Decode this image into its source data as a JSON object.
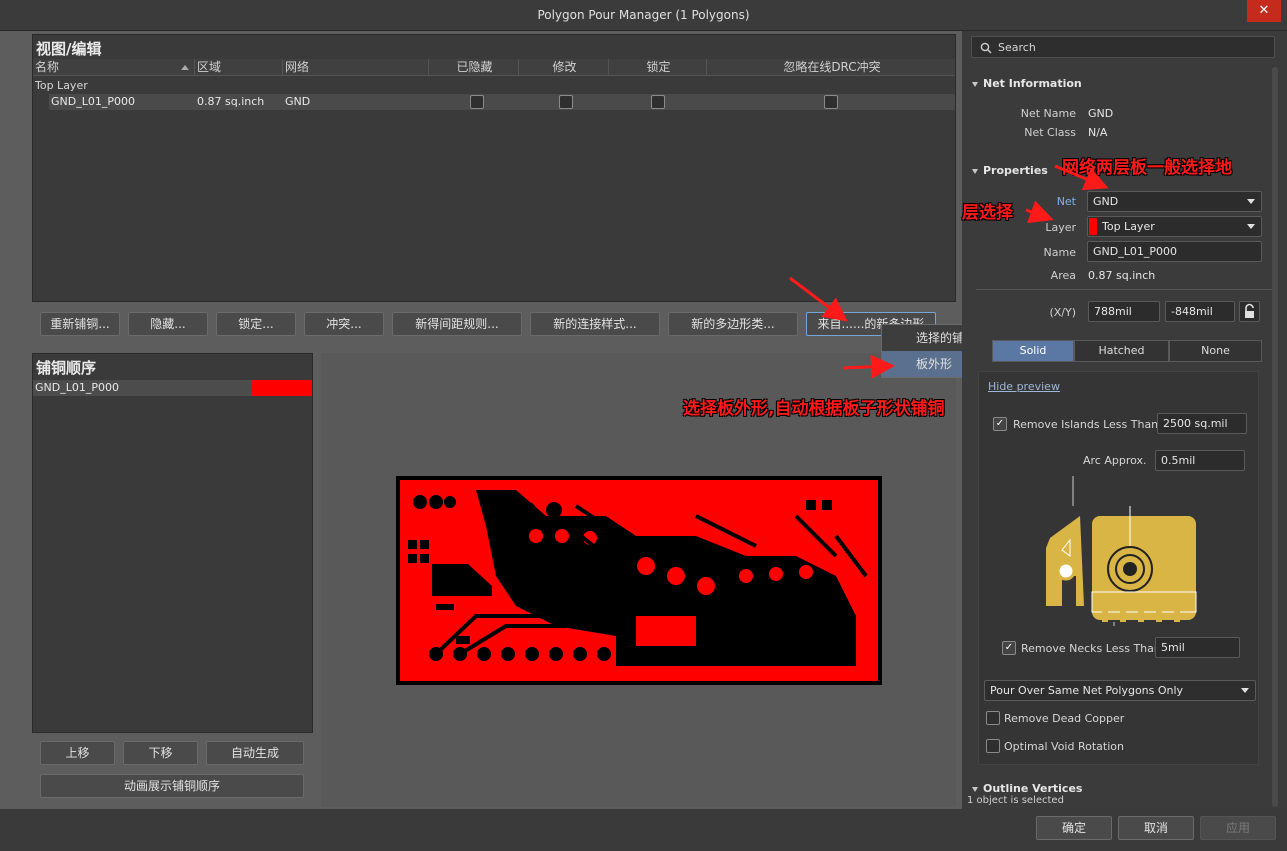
{
  "window": {
    "title": "Polygon Pour Manager (1 Polygons)",
    "close_glyph": "✕"
  },
  "view_edit": {
    "header": "视图/编辑",
    "columns": [
      "名称",
      "区域",
      "网络",
      "已隐藏",
      "修改",
      "锁定",
      "忽略在线DRC冲突"
    ],
    "group": "Top Layer",
    "row": {
      "name": "GND_L01_P000",
      "area": "0.87 sq.inch",
      "net": "GND"
    }
  },
  "buttons": {
    "repour": "重新铺铜...",
    "hide": "隐藏...",
    "lock": "锁定...",
    "conflict": "冲突...",
    "new_clearance": "新得间距规则...",
    "new_connect": "新的连接样式...",
    "new_polygon": "新的多边形类...",
    "from_new": "来自......的新多边形"
  },
  "context_menu": {
    "items": [
      "选择的铺铜",
      "板外形"
    ]
  },
  "pour_order": {
    "header": "铺铜顺序",
    "item": "GND_L01_P000",
    "move_up": "上移",
    "move_down": "下移",
    "auto": "自动生成",
    "animate": "动画展示铺铜顺序"
  },
  "right_panel": {
    "search_placeholder": "Search",
    "net_info": {
      "title": "Net Information",
      "net_name_label": "Net Name",
      "net_name": "GND",
      "net_class_label": "Net Class",
      "net_class": "N/A"
    },
    "properties": {
      "title": "Properties",
      "net_label": "Net",
      "net": "GND",
      "layer_label": "Layer",
      "layer": "Top Layer",
      "name_label": "Name",
      "name": "GND_L01_P000",
      "area_label": "Area",
      "area": "0.87 sq.inch",
      "xy_label": "(X/Y)",
      "x": "788mil",
      "y": "-848mil"
    },
    "fill_modes": [
      "Solid",
      "Hatched",
      "None"
    ],
    "hide_preview": "Hide preview",
    "remove_islands_label": "Remove Islands Less Than",
    "remove_islands": "2500 sq.mil",
    "arc_label": "Arc Approx.",
    "arc": "0.5mil",
    "remove_necks_label": "Remove Necks Less Than",
    "remove_necks": "5mil",
    "pour_over": "Pour Over Same Net Polygons Only",
    "remove_dead": "Remove Dead Copper",
    "optimal_void": "Optimal Void Rotation",
    "outline": "Outline Vertices",
    "selected": "1 object is selected"
  },
  "footer": {
    "ok": "确定",
    "cancel": "取消",
    "apply": "应用"
  },
  "annotations": {
    "net_hint": "网络两层板一般选择地",
    "layer_hint": "层选择",
    "outline_hint": "选择板外形,自动根据板子形状铺铜"
  },
  "colors": {
    "accent": "#5b77a3",
    "copper": "#ff0000",
    "annotation": "#ff1a1a",
    "preview_gold": "#d9b545"
  }
}
